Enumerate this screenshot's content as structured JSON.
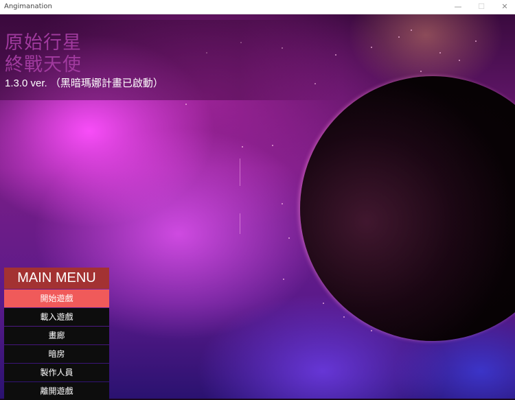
{
  "window": {
    "title": "Angimanation",
    "minimize_icon": "—",
    "maximize_icon": "☐",
    "close_icon": "✕"
  },
  "game": {
    "title_line1": "原始行星",
    "title_line2": "終戰天使",
    "version": "1.3.0 ver. （黑暗瑪娜計畫已啟動）"
  },
  "menu": {
    "header": "MAIN MENU",
    "items": [
      {
        "label": "開始遊戲",
        "active": true
      },
      {
        "label": "載入遊戲",
        "active": false
      },
      {
        "label": "畫廊",
        "active": false
      },
      {
        "label": "暗房",
        "active": false
      },
      {
        "label": "製作人員",
        "active": false
      },
      {
        "label": "離開遊戲",
        "active": false
      }
    ]
  },
  "colors": {
    "menu_header": "#a33232",
    "menu_active": "#f05a5a",
    "menu_item": "#0d0d0d",
    "title_text": "#a03a9e"
  }
}
